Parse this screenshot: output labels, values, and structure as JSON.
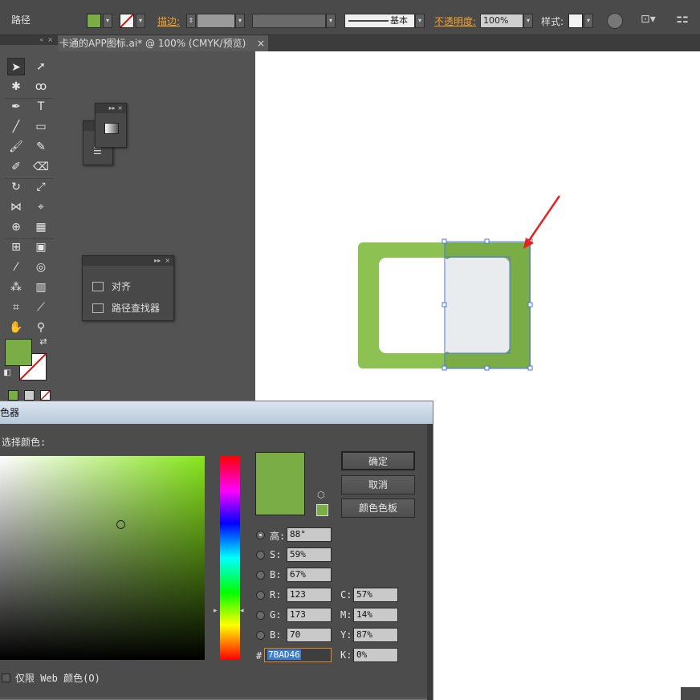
{
  "control_bar": {
    "selection_label": "路径",
    "fill_color": "#7BAD46",
    "stroke_label": "描边:",
    "brush_label": "基本",
    "opacity_label": "不透明度:",
    "opacity_value": "100%",
    "style_label": "样式:"
  },
  "document_tab": {
    "title": "卡通的APP图标.ai* @ 100% (CMYK/预览)",
    "close": "×"
  },
  "panels": {
    "align_label": "对齐",
    "pathfinder_label": "路径查找器"
  },
  "color_picker": {
    "title": "色器",
    "select_label": "选择颜色:",
    "ok_label": "确定",
    "cancel_label": "取消",
    "swatches_label": "颜色色板",
    "h_label": "高:",
    "h_value": "88°",
    "s_label": "S:",
    "s_value": "59%",
    "b_label": "B:",
    "b_value": "67%",
    "r_label": "R:",
    "r_value": "123",
    "g_label": "G:",
    "g_value": "173",
    "b2_label": "B:",
    "b2_value": "70",
    "c_label": "C:",
    "c_value": "57%",
    "m_label": "M:",
    "m_value": "14%",
    "y_label": "Y:",
    "y_value": "87%",
    "k_label": "K:",
    "k_value": "0%",
    "hex_label": "#",
    "hex_value": "7BAD46",
    "web_only_label": "仅限 Web 颜色(O)",
    "current_color": "#7BAD46",
    "field_hue_color": "#86E61A"
  },
  "artwork": {
    "outer_color": "#8DC151",
    "inner_color": "#7BAD46",
    "hole_left_color": "#FFFFFF",
    "hole_right_color": "#E9ECEF",
    "selection_color": "#4B73E6",
    "arrow_color": "#E82121"
  }
}
